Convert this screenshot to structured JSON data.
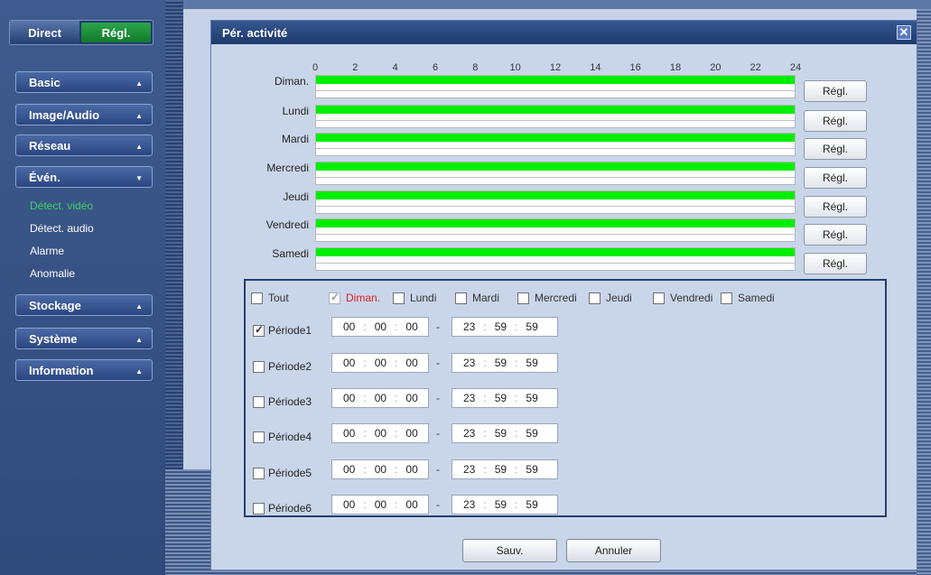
{
  "nav": {
    "direct": "Direct",
    "settings": "Régl."
  },
  "sidebar": {
    "menus": [
      {
        "label": "Basic",
        "arrow": "▲"
      },
      {
        "label": "Image/Audio",
        "arrow": "▲"
      },
      {
        "label": "Réseau",
        "arrow": "▲"
      },
      {
        "label": "Évén.",
        "arrow": "▼"
      },
      {
        "label": "Stockage",
        "arrow": "▲"
      },
      {
        "label": "Système",
        "arrow": "▲"
      },
      {
        "label": "Information",
        "arrow": "▲"
      }
    ],
    "event_sub": [
      "Détect. vidéo",
      "Détect. audio",
      "Alarme",
      "Anomalie"
    ]
  },
  "dialog": {
    "title": "Pér. activité",
    "close": "✕",
    "hours": [
      "0",
      "2",
      "4",
      "6",
      "8",
      "10",
      "12",
      "14",
      "16",
      "18",
      "20",
      "22",
      "24"
    ],
    "days": [
      "Diman.",
      "Lundi",
      "Mardi",
      "Mercredi",
      "Jeudi",
      "Vendredi",
      "Samedi"
    ],
    "row_button": "Régl.",
    "select_all": "Tout",
    "day_options": [
      {
        "label": "Diman.",
        "checked": true
      },
      {
        "label": "Lundi",
        "checked": false
      },
      {
        "label": "Mardi",
        "checked": false
      },
      {
        "label": "Mercredi",
        "checked": false
      },
      {
        "label": "Jeudi",
        "checked": false
      },
      {
        "label": "Vendredi",
        "checked": false
      },
      {
        "label": "Samedi",
        "checked": false
      }
    ],
    "periods": [
      {
        "label": "Période1",
        "checked": true,
        "start": [
          "00",
          "00",
          "00"
        ],
        "end": [
          "23",
          "59",
          "59"
        ]
      },
      {
        "label": "Période2",
        "checked": false,
        "start": [
          "00",
          "00",
          "00"
        ],
        "end": [
          "23",
          "59",
          "59"
        ]
      },
      {
        "label": "Période3",
        "checked": false,
        "start": [
          "00",
          "00",
          "00"
        ],
        "end": [
          "23",
          "59",
          "59"
        ]
      },
      {
        "label": "Période4",
        "checked": false,
        "start": [
          "00",
          "00",
          "00"
        ],
        "end": [
          "23",
          "59",
          "59"
        ]
      },
      {
        "label": "Période5",
        "checked": false,
        "start": [
          "00",
          "00",
          "00"
        ],
        "end": [
          "23",
          "59",
          "59"
        ]
      },
      {
        "label": "Période6",
        "checked": false,
        "start": [
          "00",
          "00",
          "00"
        ],
        "end": [
          "23",
          "59",
          "59"
        ]
      }
    ],
    "time_sep": ":",
    "range_sep": "-",
    "save": "Sauv.",
    "cancel": "Annuler",
    "colors": {
      "active_band": "#00ee00",
      "accent_green": "#1e8e3a"
    }
  }
}
